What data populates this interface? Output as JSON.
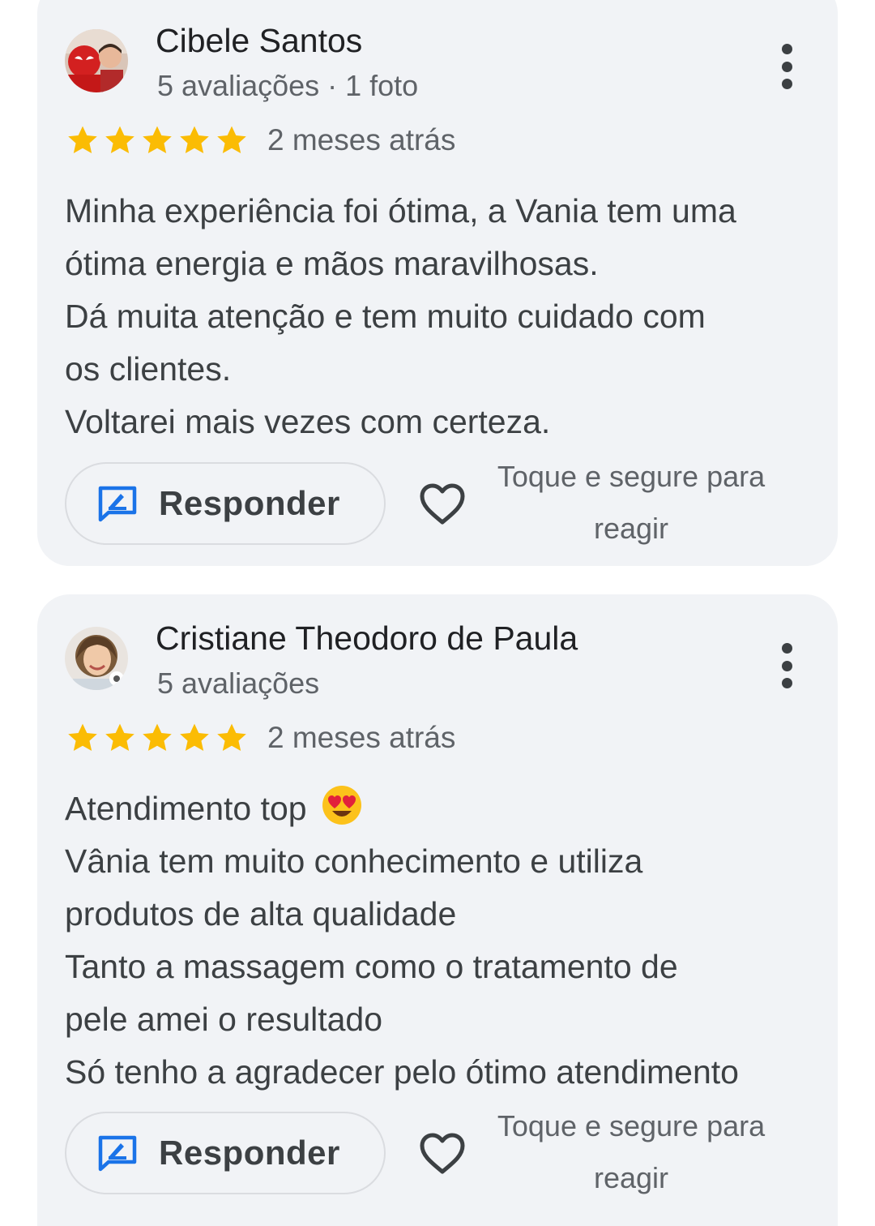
{
  "colors": {
    "star": "#fbbc04",
    "accent_blue": "#1a73e8",
    "card_bg": "#f1f3f6"
  },
  "reviews": [
    {
      "author": "Cibele Santos",
      "meta": "5 avaliações · 1 foto",
      "rating": 5,
      "date": "2 meses atrás",
      "body": [
        "Minha experiência foi ótima, a Vania tem uma",
        "ótima energia e mãos maravilhosas.",
        "Dá muita atenção e tem muito cuidado com",
        "os clientes.",
        "Voltarei mais vezes com certeza."
      ],
      "reply_label": "Responder",
      "react_hint_line1": "Toque e segure para",
      "react_hint_line2": "reagir",
      "avatar_icon": "avatar-photo"
    },
    {
      "author": "Cristiane Theodoro de Paula",
      "meta": "5 avaliações",
      "rating": 5,
      "date": "2 meses atrás",
      "body": [
        "Atendimento top",
        "Vânia tem muito conhecimento e utiliza",
        "produtos de alta qualidade",
        "Tanto a massagem como o tratamento de",
        "pele amei o resultado",
        "Só tenho a agradecer pelo ótimo atendimento"
      ],
      "body_emoji": "heart-eyes-emoji",
      "reply_label": "Responder",
      "react_hint_line1": "Toque e segure para",
      "react_hint_line2": "reagir",
      "avatar_icon": "avatar-photo"
    }
  ]
}
